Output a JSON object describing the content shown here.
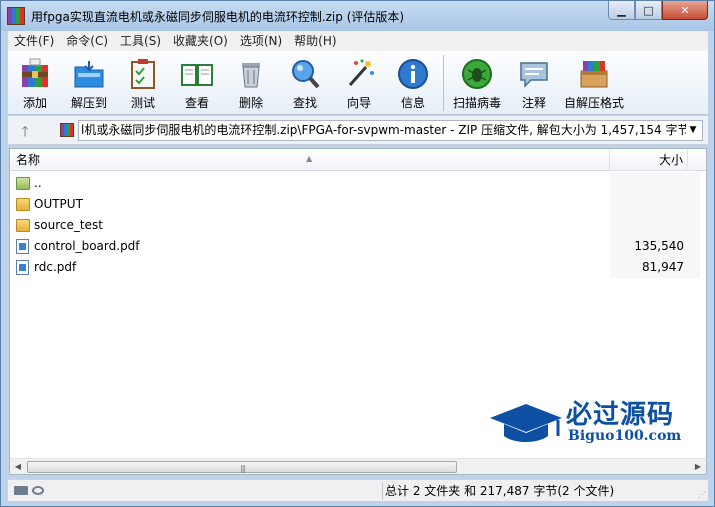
{
  "window": {
    "title": "用fpga实现直流电机或永磁同步伺服电机的电流环控制.zip (评估版本)"
  },
  "menu": [
    "文件(F)",
    "命令(C)",
    "工具(S)",
    "收藏夹(O)",
    "选项(N)",
    "帮助(H)"
  ],
  "toolbar": {
    "add": "添加",
    "extract": "解压到",
    "test": "测试",
    "view": "查看",
    "delete": "删除",
    "find": "查找",
    "wizard": "向导",
    "info": "信息",
    "scan": "扫描病毒",
    "comment": "注释",
    "sfx": "自解压格式"
  },
  "address": {
    "path": "l机或永磁同步伺服电机的电流环控制.zip\\FPGA-for-svpwm-master - ZIP 压缩文件, 解包大小为 1,457,154 字节"
  },
  "list": {
    "col_name": "名称",
    "col_size": "大小",
    "rows": [
      {
        "name": "..",
        "size": "",
        "type": "up"
      },
      {
        "name": "OUTPUT",
        "size": "",
        "type": "folder"
      },
      {
        "name": "source_test",
        "size": "",
        "type": "folder"
      },
      {
        "name": "control_board.pdf",
        "size": "135,540",
        "type": "pdf"
      },
      {
        "name": "rdc.pdf",
        "size": "81,947",
        "type": "pdf"
      }
    ]
  },
  "watermark": {
    "title": "必过源码",
    "subtitle": "Biguo100.com"
  },
  "status": {
    "summary": "总计 2 文件夹 和 217,487 字节(2 个文件)"
  },
  "colors": {
    "title_bar": "#bcd3ea",
    "watermark": "#0d4fa3"
  }
}
